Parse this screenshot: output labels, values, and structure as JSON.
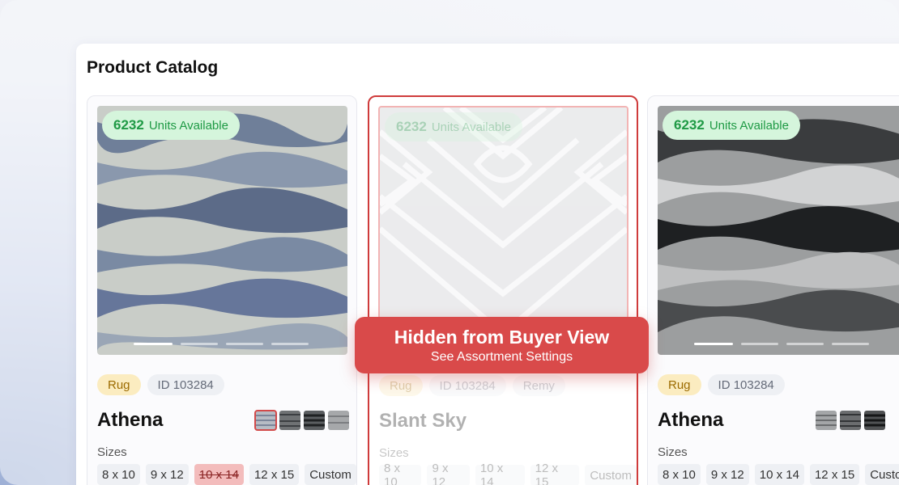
{
  "page": {
    "title": "Product Catalog"
  },
  "products": [
    {
      "stock_count": "6232",
      "stock_label": "Units Available",
      "type": "Rug",
      "id": "ID 103284",
      "name": "Athena",
      "sizes_label": "Sizes",
      "sizes": [
        "8 x 10",
        "9 x 12",
        "10 x 14",
        "12 x 15",
        "Custom"
      ],
      "unavailable_size": "10 x 14"
    },
    {
      "stock_count": "6232",
      "stock_label": "Units Available",
      "type": "Rug",
      "id": "ID 103284",
      "collection": "Remy",
      "name": "Slant Sky",
      "sizes_label": "Sizes",
      "sizes": [
        "8 x 10",
        "9 x 12",
        "10 x 14",
        "12 x 15",
        "Custom"
      ]
    },
    {
      "stock_count": "6232",
      "stock_label": "Units Available",
      "type": "Rug",
      "id": "ID 103284",
      "name": "Athena",
      "sizes_label": "Sizes",
      "sizes": [
        "8 x 10",
        "9 x 12",
        "10 x 14",
        "12 x 15",
        "Custom"
      ]
    }
  ],
  "hidden_notice": {
    "title": "Hidden from Buyer View",
    "subtitle": "See Assortment Settings"
  },
  "colors": {
    "hidden_red": "#d94a4a",
    "stock_green": "#1f9a45",
    "stock_bg": "#d5f5dc",
    "tag_type_bg": "#fbecc0",
    "tag_id_bg": "#eef0f4"
  }
}
